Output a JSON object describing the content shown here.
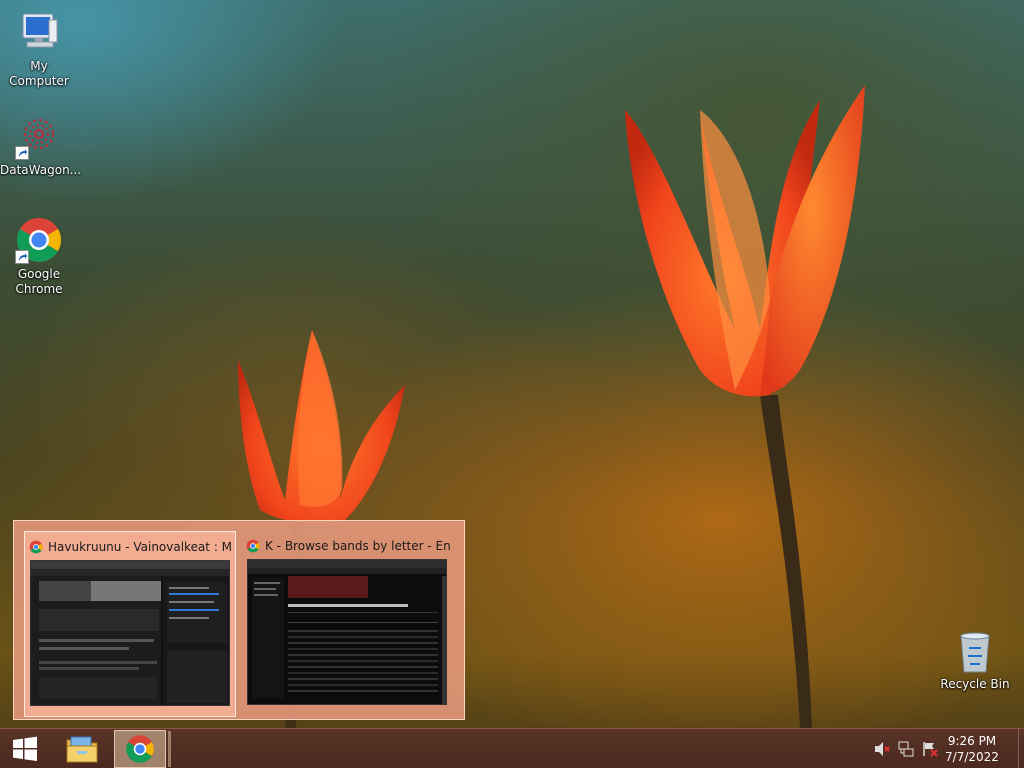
{
  "desktop": {
    "icons": [
      {
        "label": "My Computer"
      },
      {
        "label": "DataWagon..."
      },
      {
        "label": "Google Chrome"
      },
      {
        "label": "Recycle Bin"
      }
    ]
  },
  "thumbnails": [
    {
      "title": "Havukruunu - Vainovalkeat : M...",
      "icon": "chrome-icon"
    },
    {
      "title": "K - Browse bands by letter - Enc...",
      "icon": "chrome-icon"
    }
  ],
  "taskbar": {
    "start_icon": "windows-logo-icon",
    "pinned": [
      {
        "name": "file-explorer-icon"
      },
      {
        "name": "chrome-icon"
      }
    ],
    "tray": [
      "volume-muted-icon",
      "network-icon",
      "action-center-icon"
    ],
    "time": "9:26 PM",
    "date": "7/7/2022"
  },
  "colors": {
    "thumb_popup": "#e1967a",
    "taskbar": "#5a3228"
  }
}
